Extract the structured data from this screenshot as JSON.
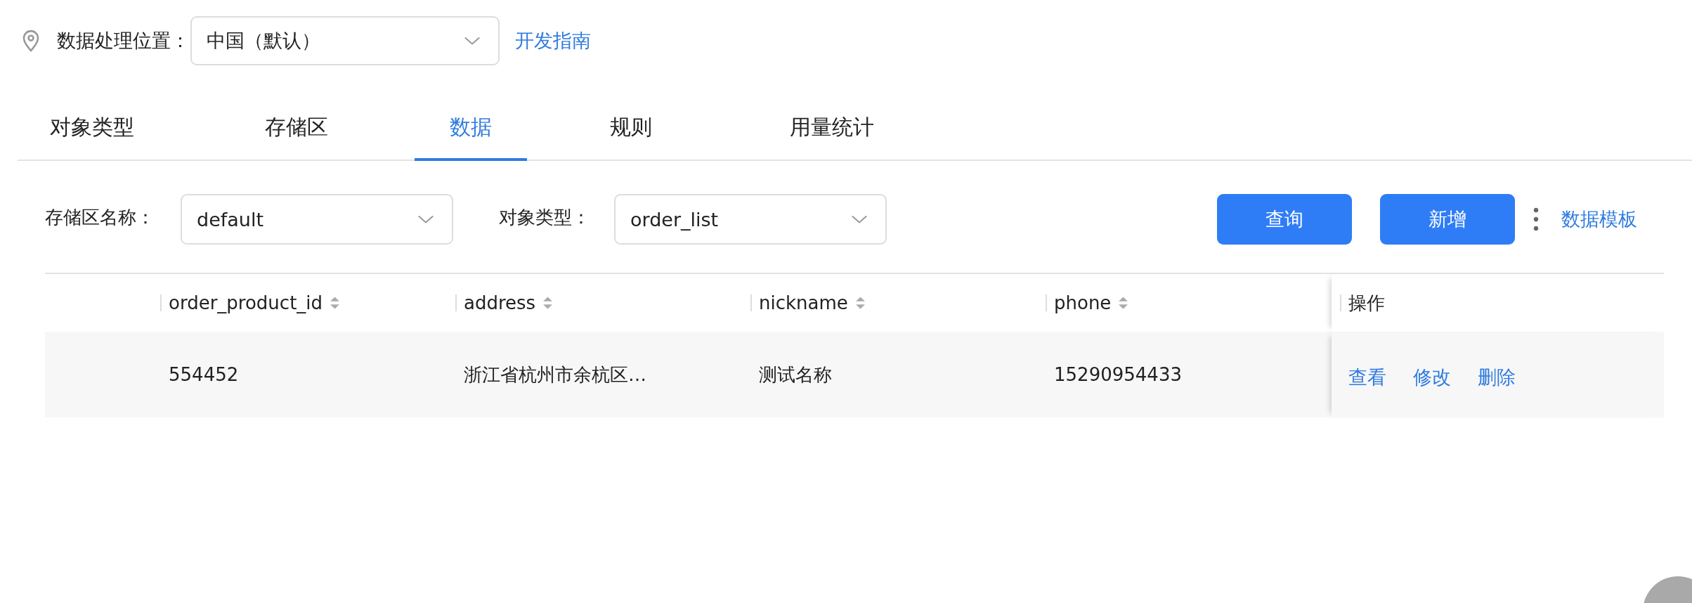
{
  "location": {
    "label": "数据处理位置：",
    "value": "中国（默认）",
    "link": "开发指南"
  },
  "tabs": [
    {
      "label": "对象类型",
      "selected": false
    },
    {
      "label": "存储区",
      "selected": false
    },
    {
      "label": "数据",
      "selected": true
    },
    {
      "label": "规则",
      "selected": false
    },
    {
      "label": "用量统计",
      "selected": false
    }
  ],
  "filters": [
    {
      "label": "存储区名称：",
      "value": "default"
    },
    {
      "label": "对象类型：",
      "value": "order_list"
    }
  ],
  "buttons": [
    "查询",
    "新增"
  ],
  "template_link": "数据模板",
  "table": {
    "columns": [
      {
        "label": "order_product_id",
        "sortable": true
      },
      {
        "label": "address",
        "sortable": true
      },
      {
        "label": "nickname",
        "sortable": true
      },
      {
        "label": "phone",
        "sortable": true
      },
      {
        "label": "操作",
        "sortable": false
      }
    ],
    "rows": [
      {
        "cells": [
          "554452",
          "浙江省杭州市余杭区…",
          "测试名称",
          "15290954433"
        ],
        "actions": [
          "查看",
          "修改",
          "删除"
        ]
      }
    ]
  }
}
